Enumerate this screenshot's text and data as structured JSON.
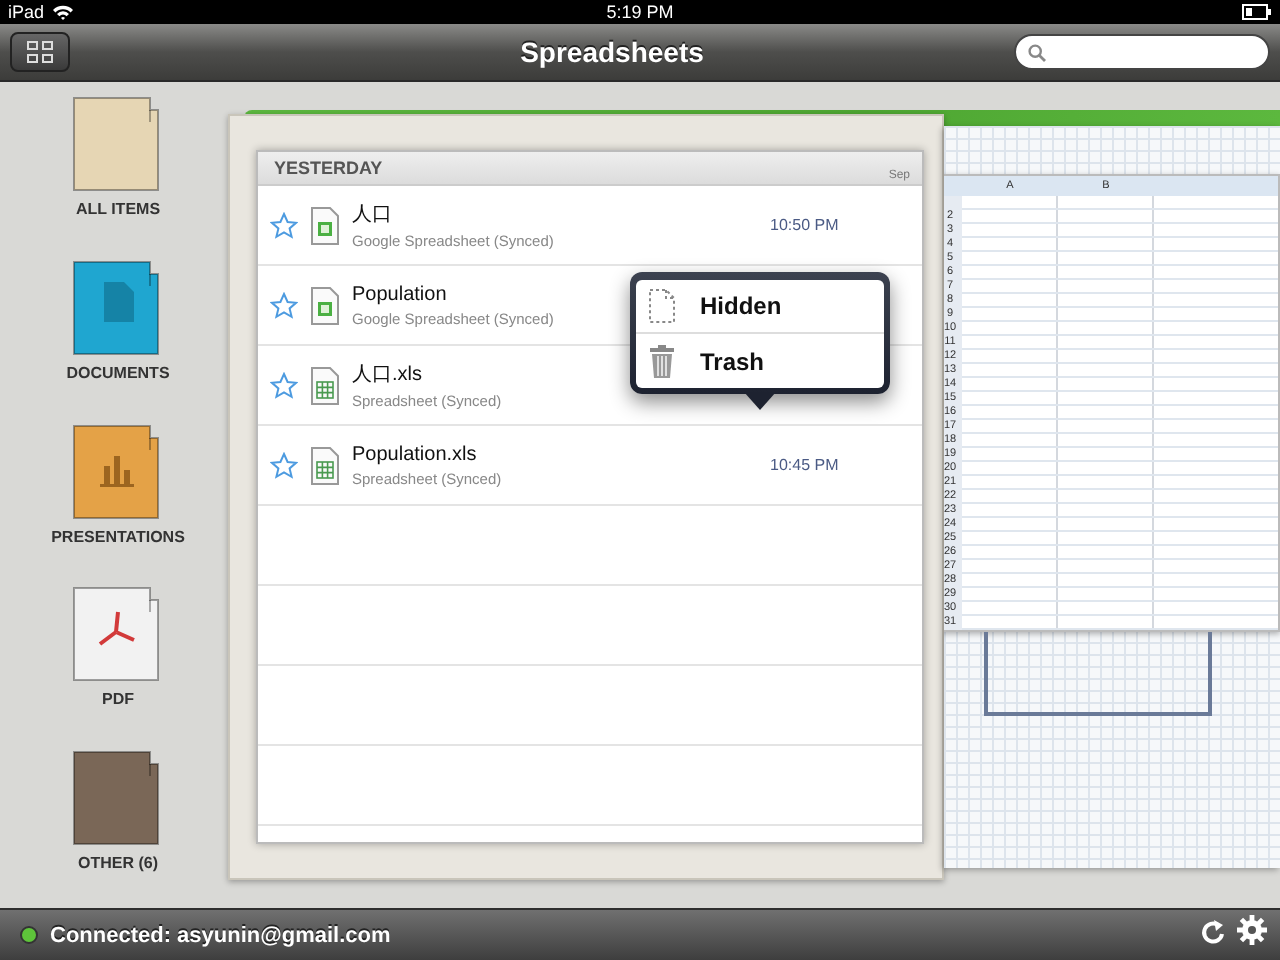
{
  "status_bar": {
    "device": "iPad",
    "time": "5:19 PM"
  },
  "nav_bar": {
    "title": "Spreadsheets"
  },
  "sidebar": {
    "items": [
      {
        "label": "ALL ITEMS",
        "kind": "all"
      },
      {
        "label": "DOCUMENTS",
        "kind": "documents"
      },
      {
        "label": "PRESENTATIONS",
        "kind": "presentations"
      },
      {
        "label": "PDF",
        "kind": "pdf"
      },
      {
        "label": "OTHER (6)",
        "kind": "other"
      }
    ]
  },
  "file_list": {
    "section": "YESTERDAY",
    "date_label": "Sep",
    "rows": [
      {
        "name": "人口",
        "type": "Google Spreadsheet (Synced)",
        "kind": "google",
        "time": "10:50 PM",
        "starred": false
      },
      {
        "name": "Population",
        "type": "Google Spreadsheet (Synced)",
        "kind": "google",
        "starred": false
      },
      {
        "name": "人口.xls",
        "type": "Spreadsheet (Synced)",
        "kind": "xls",
        "starred": false
      },
      {
        "name": "Population.xls",
        "type": "Spreadsheet (Synced)",
        "kind": "xls",
        "time": "10:45 PM",
        "starred": false
      }
    ]
  },
  "popover": {
    "items": [
      {
        "label": "Hidden",
        "kind": "hidden"
      },
      {
        "label": "Trash",
        "kind": "trash"
      }
    ]
  },
  "sheet_preview": {
    "columns": [
      "A",
      "B"
    ],
    "rows": [
      "2",
      "3",
      "4",
      "5",
      "6",
      "7",
      "8",
      "9",
      "10",
      "11",
      "12",
      "13",
      "14",
      "15",
      "16",
      "17",
      "18",
      "19",
      "20",
      "21",
      "22",
      "23",
      "24",
      "25",
      "26",
      "27",
      "28",
      "29",
      "30",
      "31"
    ]
  },
  "footer": {
    "status": "Connected: asyunin@gmail.com",
    "connected": true
  }
}
